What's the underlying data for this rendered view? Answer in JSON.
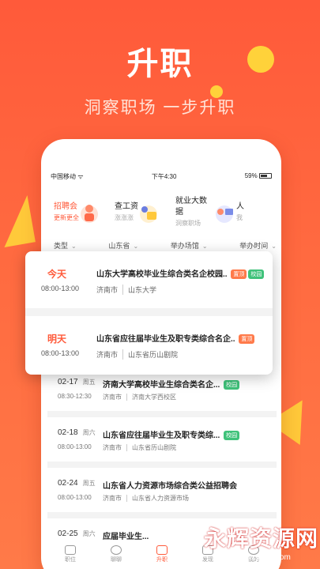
{
  "hero": {
    "title": "升职",
    "subtitle": "洞察职场 一步升职"
  },
  "status_bar": {
    "carrier": "中国移动",
    "time": "下午4:30",
    "battery": "59%"
  },
  "quick_links": [
    {
      "title": "招聘会",
      "sub": "更新更全",
      "highlight": true
    },
    {
      "title": "查工资",
      "sub": "涨涨涨"
    },
    {
      "title": "就业大数据",
      "sub": "洞察职场"
    },
    {
      "title": "人",
      "sub": "我"
    }
  ],
  "filters": [
    "类型",
    "山东省",
    "举办场馆",
    "举办时间"
  ],
  "popup": [
    {
      "day": "今天",
      "time": "08:00-13:00",
      "title": "山东大学高校毕业生综合类名企校园..",
      "tags": [
        "置顶",
        "校园"
      ],
      "city": "济南市",
      "venue": "山东大学"
    },
    {
      "day": "明天",
      "time": "08:00-13:00",
      "title": "山东省应往届毕业生及职专类综合名企..",
      "tags": [
        "置顶"
      ],
      "city": "济南市",
      "venue": "山东省历山剧院"
    }
  ],
  "list": [
    {
      "date": "02-17",
      "weekday": "周五",
      "title": "济南大学高校毕业生综合类名企...",
      "tag": "校园",
      "time": "08:30-12:30",
      "city": "济南市",
      "venue": "济南大学西校区"
    },
    {
      "date": "02-18",
      "weekday": "周六",
      "title": "山东省应往届毕业生及职专类综...",
      "tag": "校园",
      "time": "08:00-13:00",
      "city": "济南市",
      "venue": "山东省历山剧院"
    },
    {
      "date": "02-24",
      "weekday": "周五",
      "title": "山东省人力资源市场综合类公益招聘会",
      "tag": "",
      "time": "08:00-13:00",
      "city": "济南市",
      "venue": "山东省人力资源市场"
    },
    {
      "date": "02-25",
      "weekday": "周六",
      "title": "应届毕业生...",
      "tag": "",
      "time": "",
      "city": "",
      "venue": ""
    }
  ],
  "tabbar": [
    {
      "label": "职位"
    },
    {
      "label": "聊聊"
    },
    {
      "label": "升职",
      "active": true
    },
    {
      "label": "发现"
    },
    {
      "label": "我的"
    }
  ],
  "watermark": {
    "text": "永辉资源网",
    "url": "www.yhkjjj.com"
  },
  "colors": {
    "brand": "#ff5a3a",
    "school_tag": "#3fc27a",
    "top_tag": "#ff7a4a"
  }
}
